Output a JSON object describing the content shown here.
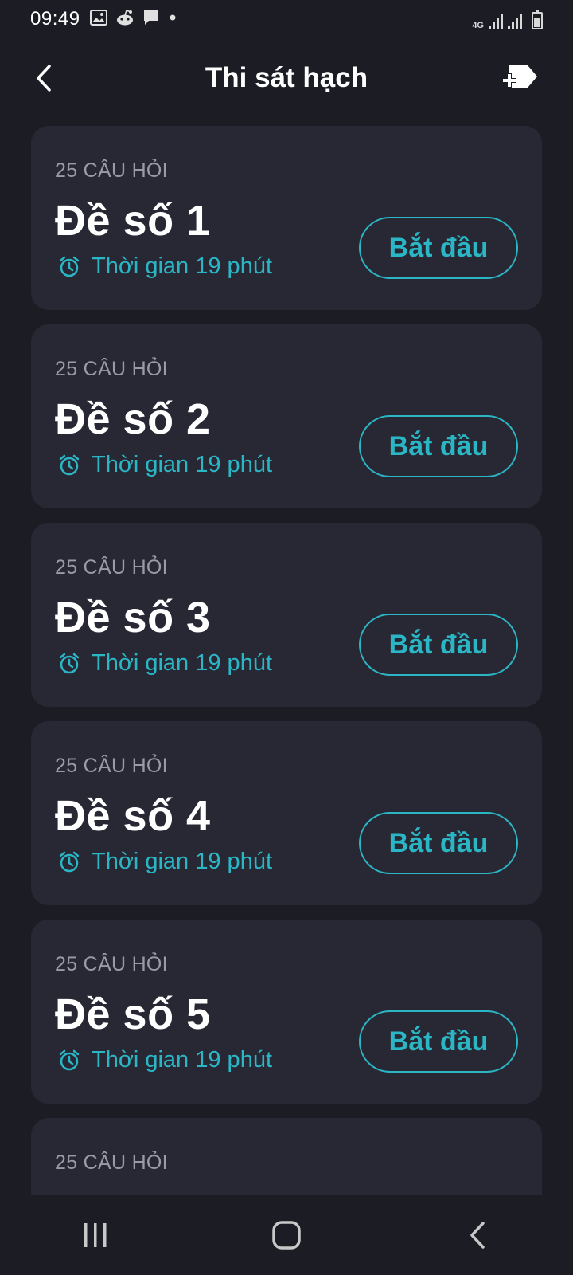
{
  "status_bar": {
    "time": "09:49",
    "left_icons": [
      "image-icon",
      "reddit-icon",
      "message-icon",
      "dot-icon"
    ],
    "network_type": "4G",
    "right_icons": [
      "signal-icon",
      "signal-icon",
      "battery-icon"
    ]
  },
  "header": {
    "title": "Thi sát hạch",
    "back_icon": "chevron-left-icon",
    "action_icon": "add-label-icon"
  },
  "exams": [
    {
      "count": "25 CÂU HỎI",
      "title": "Đề số 1",
      "time": "Thời gian 19 phút",
      "button": "Bắt đầu"
    },
    {
      "count": "25 CÂU HỎI",
      "title": "Đề số 2",
      "time": "Thời gian 19 phút",
      "button": "Bắt đầu"
    },
    {
      "count": "25 CÂU HỎI",
      "title": "Đề số 3",
      "time": "Thời gian 19 phút",
      "button": "Bắt đầu"
    },
    {
      "count": "25 CÂU HỎI",
      "title": "Đề số 4",
      "time": "Thời gian 19 phút",
      "button": "Bắt đầu"
    },
    {
      "count": "25 CÂU HỎI",
      "title": "Đề số 5",
      "time": "Thời gian 19 phút",
      "button": "Bắt đầu"
    },
    {
      "count": "25 CÂU HỎI"
    }
  ],
  "nav_bar": {
    "buttons": [
      "recent-apps-icon",
      "home-icon",
      "back-icon"
    ]
  },
  "colors": {
    "background": "#1b1c24",
    "card": "#272833",
    "accent": "#2bb6c6",
    "muted_text": "#9a9ba6"
  }
}
